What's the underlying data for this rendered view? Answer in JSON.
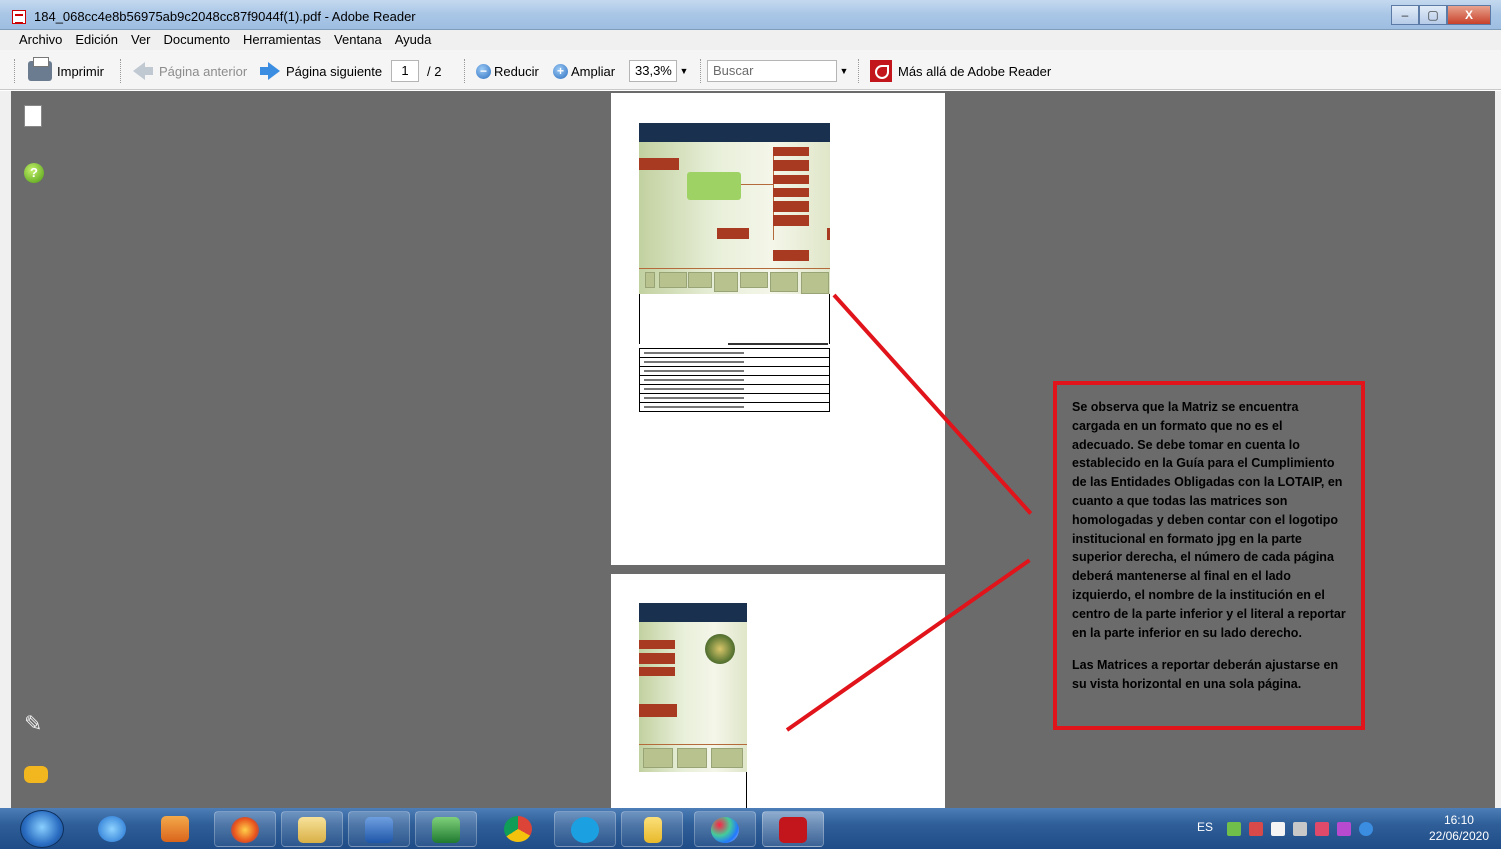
{
  "window": {
    "title": "184_068cc4e8b56975ab9c2048cc87f9044f(1).pdf - Adobe Reader",
    "controls": [
      "–",
      "▢",
      "X"
    ]
  },
  "menu": {
    "items": [
      "Archivo",
      "Edición",
      "Ver",
      "Documento",
      "Herramientas",
      "Ventana",
      "Ayuda"
    ]
  },
  "toolbar": {
    "print": "Imprimir",
    "prev_page": "Página anterior",
    "next_page": "Página siguiente",
    "current_page": "1",
    "total_pages": "/ 2",
    "zoom_out": "Reducir",
    "zoom_in": "Ampliar",
    "zoom_value": "33,3%",
    "search_placeholder": "Buscar",
    "more": "Más allá de Adobe Reader"
  },
  "annotation": {
    "paragraph1": "Se observa que la Matriz se encuentra cargada en un formato que no es el adecuado. Se debe tomar en cuenta lo establecido en la Guía para el Cumplimiento de las Entidades Obligadas con la LOTAIP, en cuanto a que todas las matrices son homologadas y deben contar con el logotipo institucional en formato jpg en la parte superior derecha, el número de cada página deberá mantenerse al final en el lado izquierdo, el nombre de la institución en el centro de la parte inferior y el literal a reportar en la parte inferior en su lado derecho.",
    "paragraph2": "Las Matrices a reportar deberán ajustarse en su vista horizontal en una sola página.",
    "border_color": "#e0141a"
  },
  "taskbar": {
    "language": "ES",
    "time": "16:10",
    "date": "22/06/2020",
    "apps": [
      "internet-explorer",
      "outlook",
      "firefox",
      "file-explorer",
      "word",
      "excel",
      "chrome",
      "skype",
      "folder",
      "paint",
      "adobe-reader"
    ]
  },
  "colors": {
    "viewer_background": "#6b6b6b",
    "accent_red": "#e0141a",
    "taskbar_blue": "#2f5e98"
  }
}
